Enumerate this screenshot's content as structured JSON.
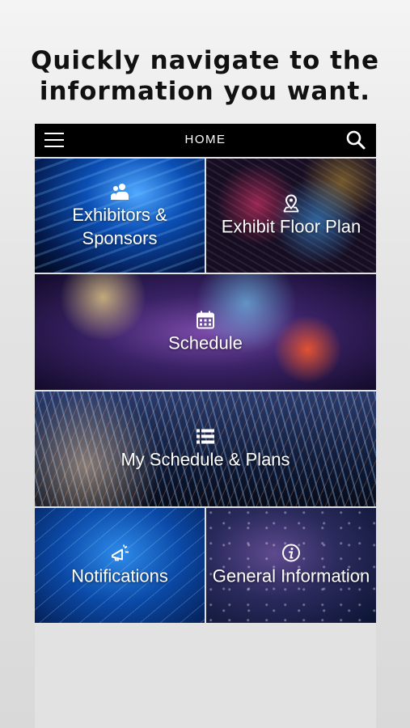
{
  "headline": {
    "line1": "Quickly navigate to the",
    "line2": "information you want."
  },
  "topbar": {
    "title": "HOME",
    "menu_icon": "hamburger-menu-icon",
    "search_icon": "search-icon"
  },
  "tiles": [
    {
      "label_line1": "Exhibitors &",
      "label_line2": "Sponsors",
      "icon": "people-icon"
    },
    {
      "label": "Exhibit Floor Plan",
      "icon": "map-pin-icon"
    },
    {
      "label": "Schedule",
      "icon": "calendar-icon"
    },
    {
      "label": "My Schedule & Plans",
      "icon": "list-icon"
    },
    {
      "label": "Notifications",
      "icon": "megaphone-icon"
    },
    {
      "label": "General Information",
      "icon": "info-icon"
    }
  ]
}
